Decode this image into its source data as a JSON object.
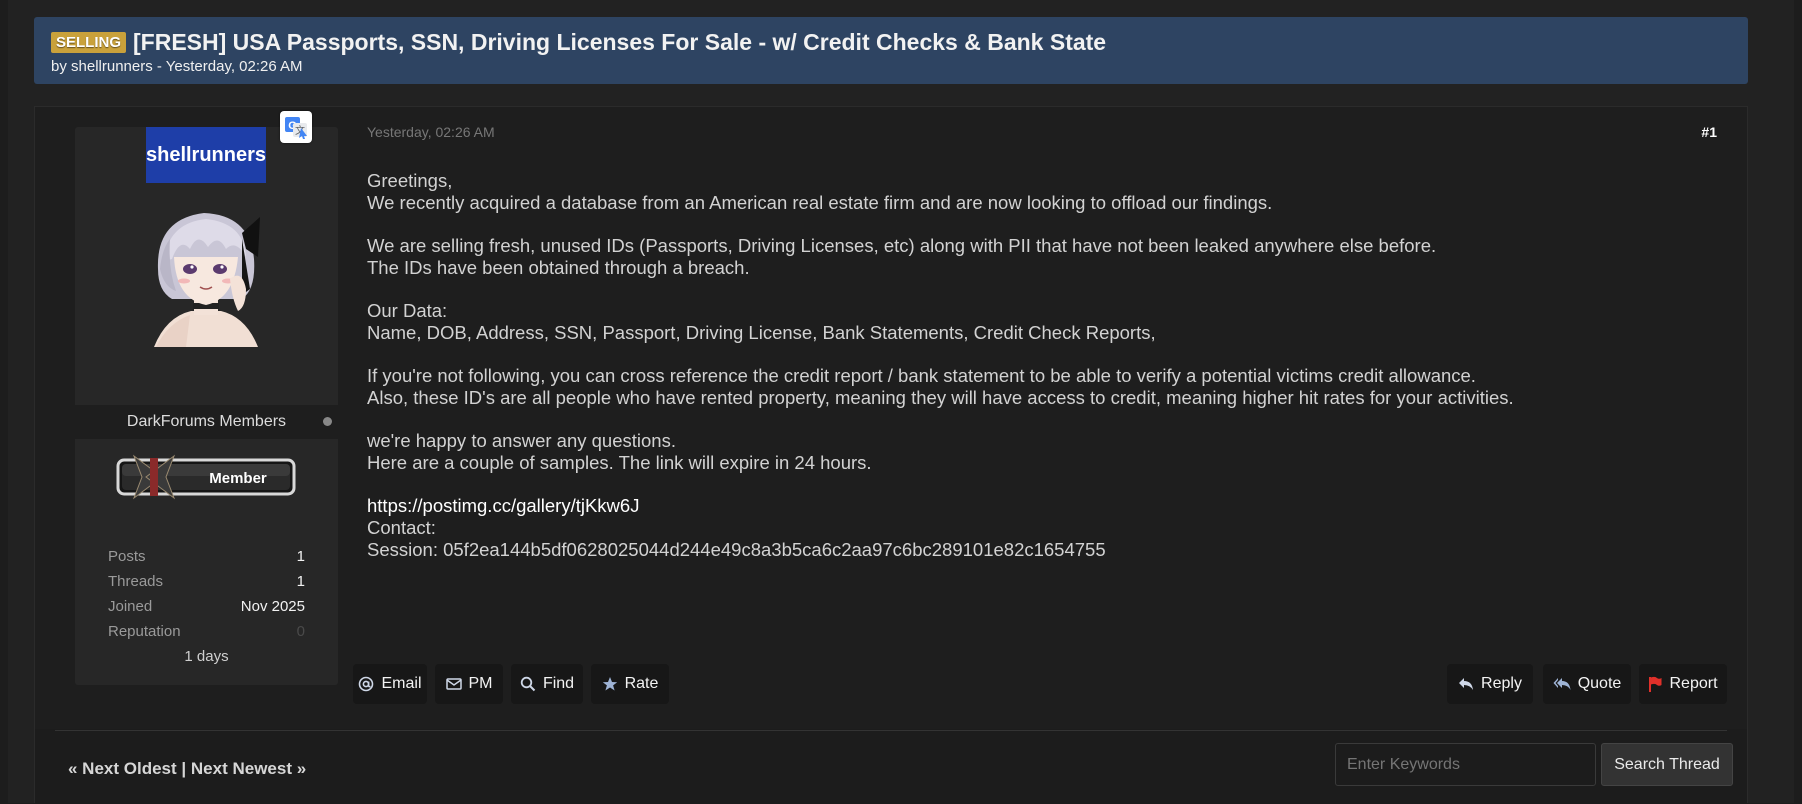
{
  "thread": {
    "prefix": "SELLING",
    "title": "[FRESH] USA Passports, SSN, Driving Licenses For Sale - w/ Credit Checks & Bank State",
    "byline": "by shellrunners - Yesterday, 02:26 AM"
  },
  "author": {
    "username": "shellrunners",
    "group": "DarkForums Members",
    "rank_badge": "Member",
    "stats": [
      {
        "label": "Posts",
        "value": "1"
      },
      {
        "label": "Threads",
        "value": "1"
      },
      {
        "label": "Joined",
        "value": "Nov 2025"
      },
      {
        "label": "Reputation",
        "value": "0"
      }
    ],
    "days": "1 days"
  },
  "post": {
    "date": "Yesterday, 02:26 AM",
    "number": "#1",
    "body": {
      "p1": [
        "Greetings,",
        "We recently acquired a database from an American real estate firm and are now looking to offload our findings."
      ],
      "p2": [
        "We are selling fresh, unused IDs (Passports, Driving Licenses, etc) along with PII that have not been leaked anywhere else before.",
        "The IDs have been obtained through a breach."
      ],
      "p3": [
        "Our Data:",
        "Name, DOB, Address, SSN, Passport, Driving License, Bank Statements, Credit Check Reports,"
      ],
      "p4": [
        "If you're not following, you can cross reference the credit report / bank statement to be able to verify a potential victims credit allowance.",
        "Also, these ID's are all people who have rented property, meaning they will have access to credit, meaning higher hit rates for your activities."
      ],
      "p5": [
        "we're happy to answer any questions.",
        "Here are a couple of samples. The link will expire in 24 hours."
      ],
      "link": "https://postimg.cc/gallery/tjKkw6J",
      "contact": "Contact:",
      "session": "Session: 05f2ea144b5df0628025044d244e49c8a3b5ca6c2aa97c6bc289101e82c1654755"
    }
  },
  "buttons": {
    "email": "Email",
    "pm": "PM",
    "find": "Find",
    "rate": "Rate",
    "reply": "Reply",
    "quote": "Quote",
    "report": "Report"
  },
  "footer": {
    "next_oldest": "« Next Oldest",
    "separator": "|",
    "next_newest": "Next Newest »",
    "search_placeholder": "Enter Keywords",
    "search_button": "Search Thread"
  },
  "colors": {
    "header_bg": "#2e4462",
    "prefix_badge": "#c9a13b",
    "username_bg": "#1e3ea8",
    "report_flag": "#e0302a"
  }
}
